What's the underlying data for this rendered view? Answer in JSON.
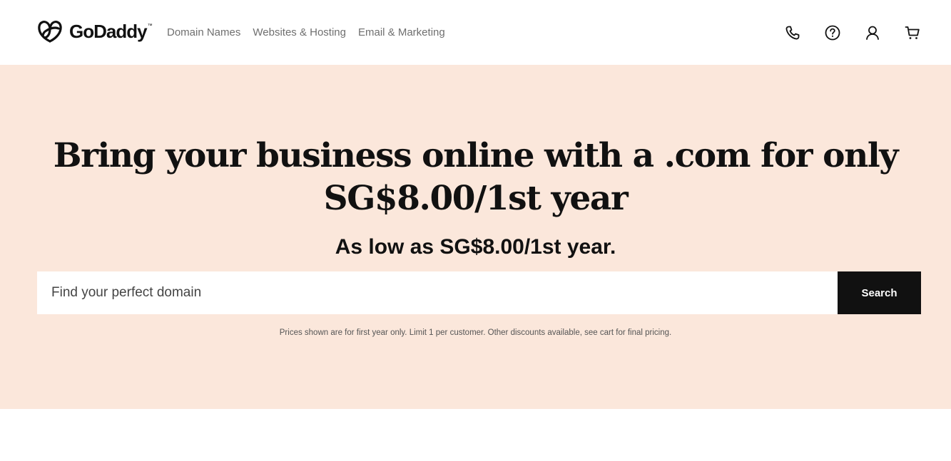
{
  "brand": {
    "name": "GoDaddy",
    "trademark": "™",
    "logo_icon": "godaddy-heart-logo-icon",
    "text_color": "#111111"
  },
  "nav": {
    "items": [
      {
        "label": "Domain Names"
      },
      {
        "label": "Websites & Hosting"
      },
      {
        "label": "Email & Marketing"
      }
    ],
    "text_color": "#6f6f6f"
  },
  "header_icons": [
    {
      "name": "phone-icon"
    },
    {
      "name": "help-icon"
    },
    {
      "name": "account-icon"
    },
    {
      "name": "cart-icon"
    }
  ],
  "hero": {
    "background": "#fbe7db",
    "headline_line1": "Bring your business online with a .com for only",
    "headline_line2": "SG$8.00/1st year",
    "subheadline": "As low as SG$8.00/1st year.",
    "search": {
      "placeholder": "Find your perfect domain",
      "value": "",
      "button_label": "Search",
      "button_color": "#111111"
    },
    "disclaimer": "Prices shown are for first year only. Limit 1 per customer. Other discounts available, see cart for final pricing."
  }
}
